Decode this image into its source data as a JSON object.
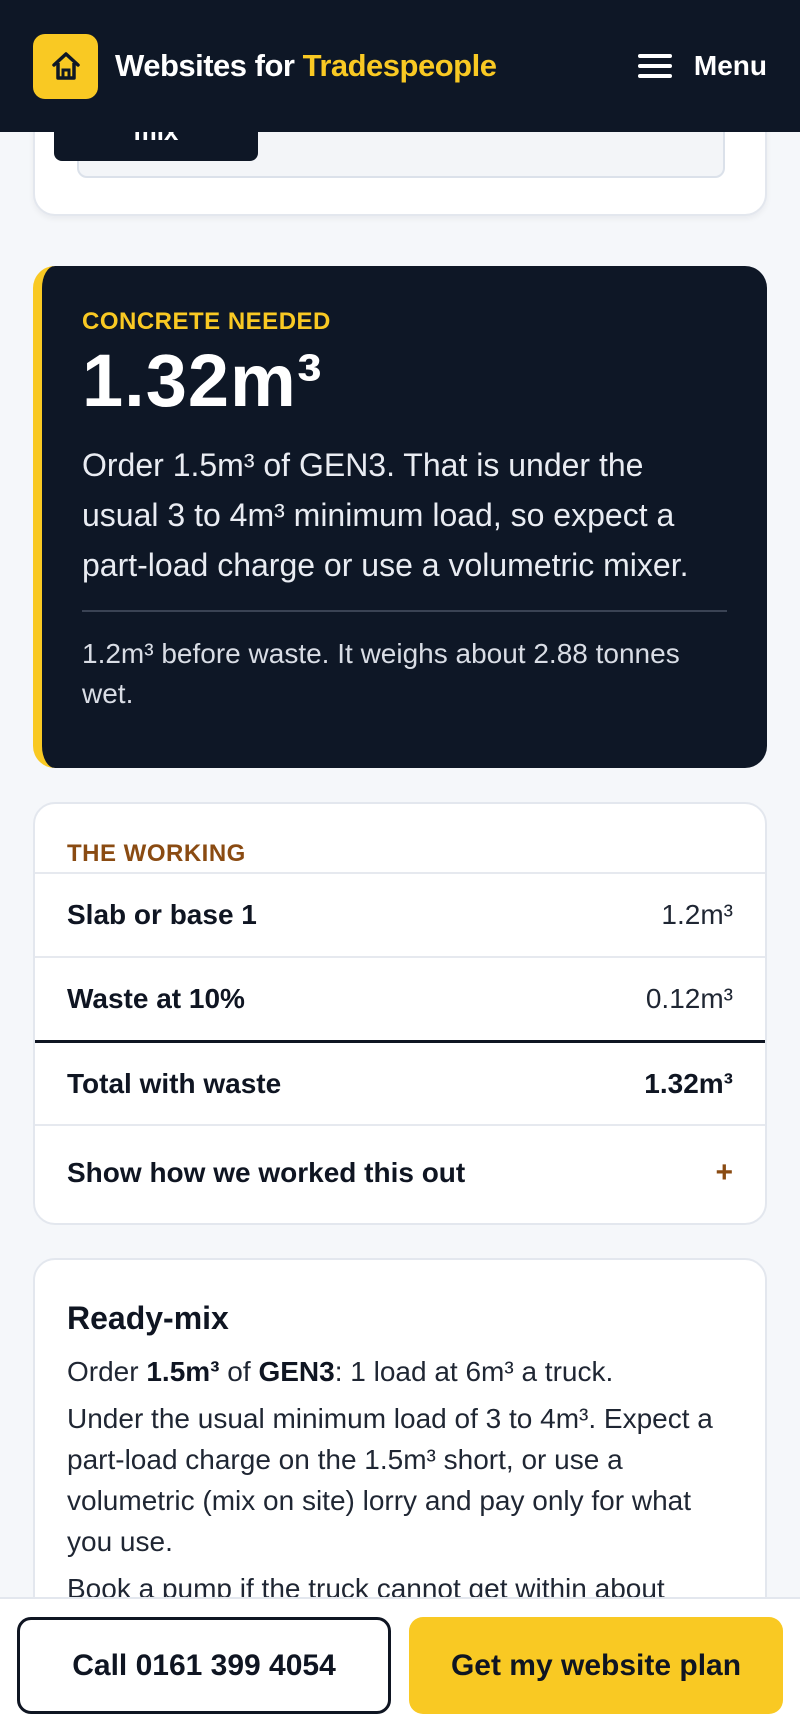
{
  "header": {
    "brand_prefix": "Websites for ",
    "brand_accent": "Tradespeople",
    "menu_label": "Menu",
    "accent_color": "#f9c923",
    "bg_color": "#0e1726",
    "logo_icon": "house-icon",
    "menu_icon": "hamburger-icon"
  },
  "top_card": {
    "button_label_fragment": "mix"
  },
  "result": {
    "kicker": "CONCRETE NEEDED",
    "amount": "1.32m³",
    "advice": "Order 1.5m³ of GEN3. That is under the usual 3 to 4m³ minimum load, so expect a part-load charge or use a volumetric mixer.",
    "detail": "1.2m³ before waste. It weighs about 2.88 tonnes wet."
  },
  "working": {
    "title": "THE WORKING",
    "rows": [
      {
        "label": "Slab or base 1",
        "value": "1.2m³"
      },
      {
        "label": "Waste at 10%",
        "value": "0.12m³"
      }
    ],
    "total": {
      "label": "Total with waste",
      "value": "1.32m³"
    },
    "expand_label": "Show how we worked this out",
    "expand_symbol": "+"
  },
  "readymix": {
    "title": "Ready-mix",
    "order_prefix": "Order ",
    "order_amount": "1.5m³",
    "order_of": " of ",
    "order_mix": "GEN3",
    "order_suffix": ": 1 load at 6m³ a truck.",
    "note": "Under the usual minimum load of 3 to 4m³. Expect a part-load charge on the 1.5m³ short, or use a volumetric (mix on site) lorry and pay only for what you use.",
    "partial": "Book a pump if the truck cannot get within about"
  },
  "bottom_bar": {
    "call_label": "Call 0161 399 4054",
    "plan_label": "Get my website plan"
  }
}
